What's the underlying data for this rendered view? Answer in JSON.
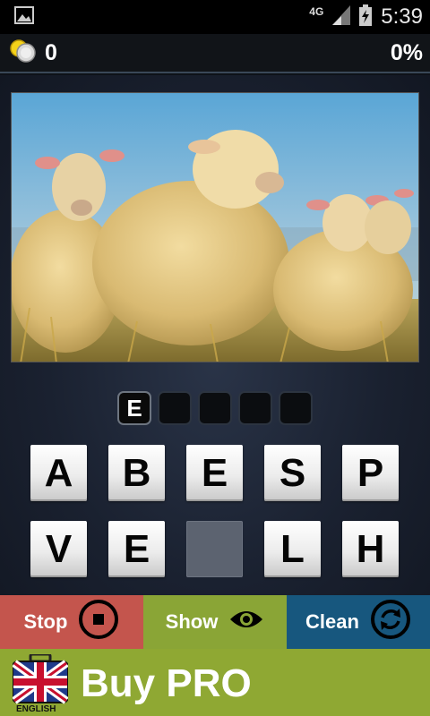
{
  "status_bar": {
    "network": "4G",
    "time": "5:39"
  },
  "score_bar": {
    "coins": "0",
    "progress": "0%"
  },
  "answer_slots": [
    "E",
    "",
    "",
    "",
    ""
  ],
  "letter_tiles": [
    "A",
    "B",
    "E",
    "S",
    "P",
    "V",
    "E",
    "",
    "L",
    "H"
  ],
  "actions": {
    "stop_label": "Stop",
    "show_label": "Show",
    "clean_label": "Clean"
  },
  "buy": {
    "label": "Buy PRO",
    "language_label": "ENGLISH"
  },
  "colors": {
    "stop": "#c4554d",
    "show": "#8aa536",
    "clean": "#17577e",
    "buy": "#8fa833"
  }
}
